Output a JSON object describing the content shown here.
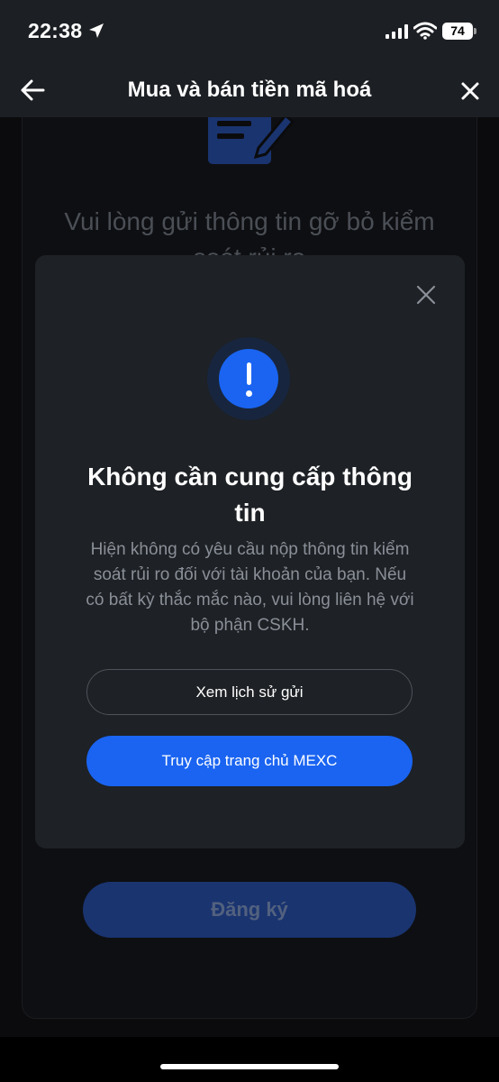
{
  "status_bar": {
    "time": "22:38",
    "battery": "74",
    "icons": [
      "location-arrow-icon",
      "cellular-signal-icon",
      "wifi-icon",
      "battery-icon"
    ]
  },
  "header": {
    "title": "Mua và bán tiền mã hoá",
    "back_icon": "arrow-left-icon",
    "close_icon": "close-icon"
  },
  "background": {
    "icon": "document-edit-icon",
    "text": "Vui lòng gửi thông tin gỡ bỏ kiểm soát rủi ro",
    "register_label": "Đăng ký"
  },
  "modal": {
    "icon": "exclamation-icon",
    "title": "Không cần cung cấp thông tin",
    "description": "Hiện không có yêu cầu nộp thông tin kiểm soát rủi ro đối với tài khoản của bạn. Nếu có bất kỳ thắc mắc nào, vui lòng liên hệ với bộ phận CSKH.",
    "history_button": "Xem lịch sử gửi",
    "home_button": "Truy cập trang chủ MEXC"
  },
  "colors": {
    "accent": "#1a64f1",
    "modal_bg": "#1e2125",
    "header_bg": "#1c1f23",
    "muted_text": "#8a8f98"
  }
}
